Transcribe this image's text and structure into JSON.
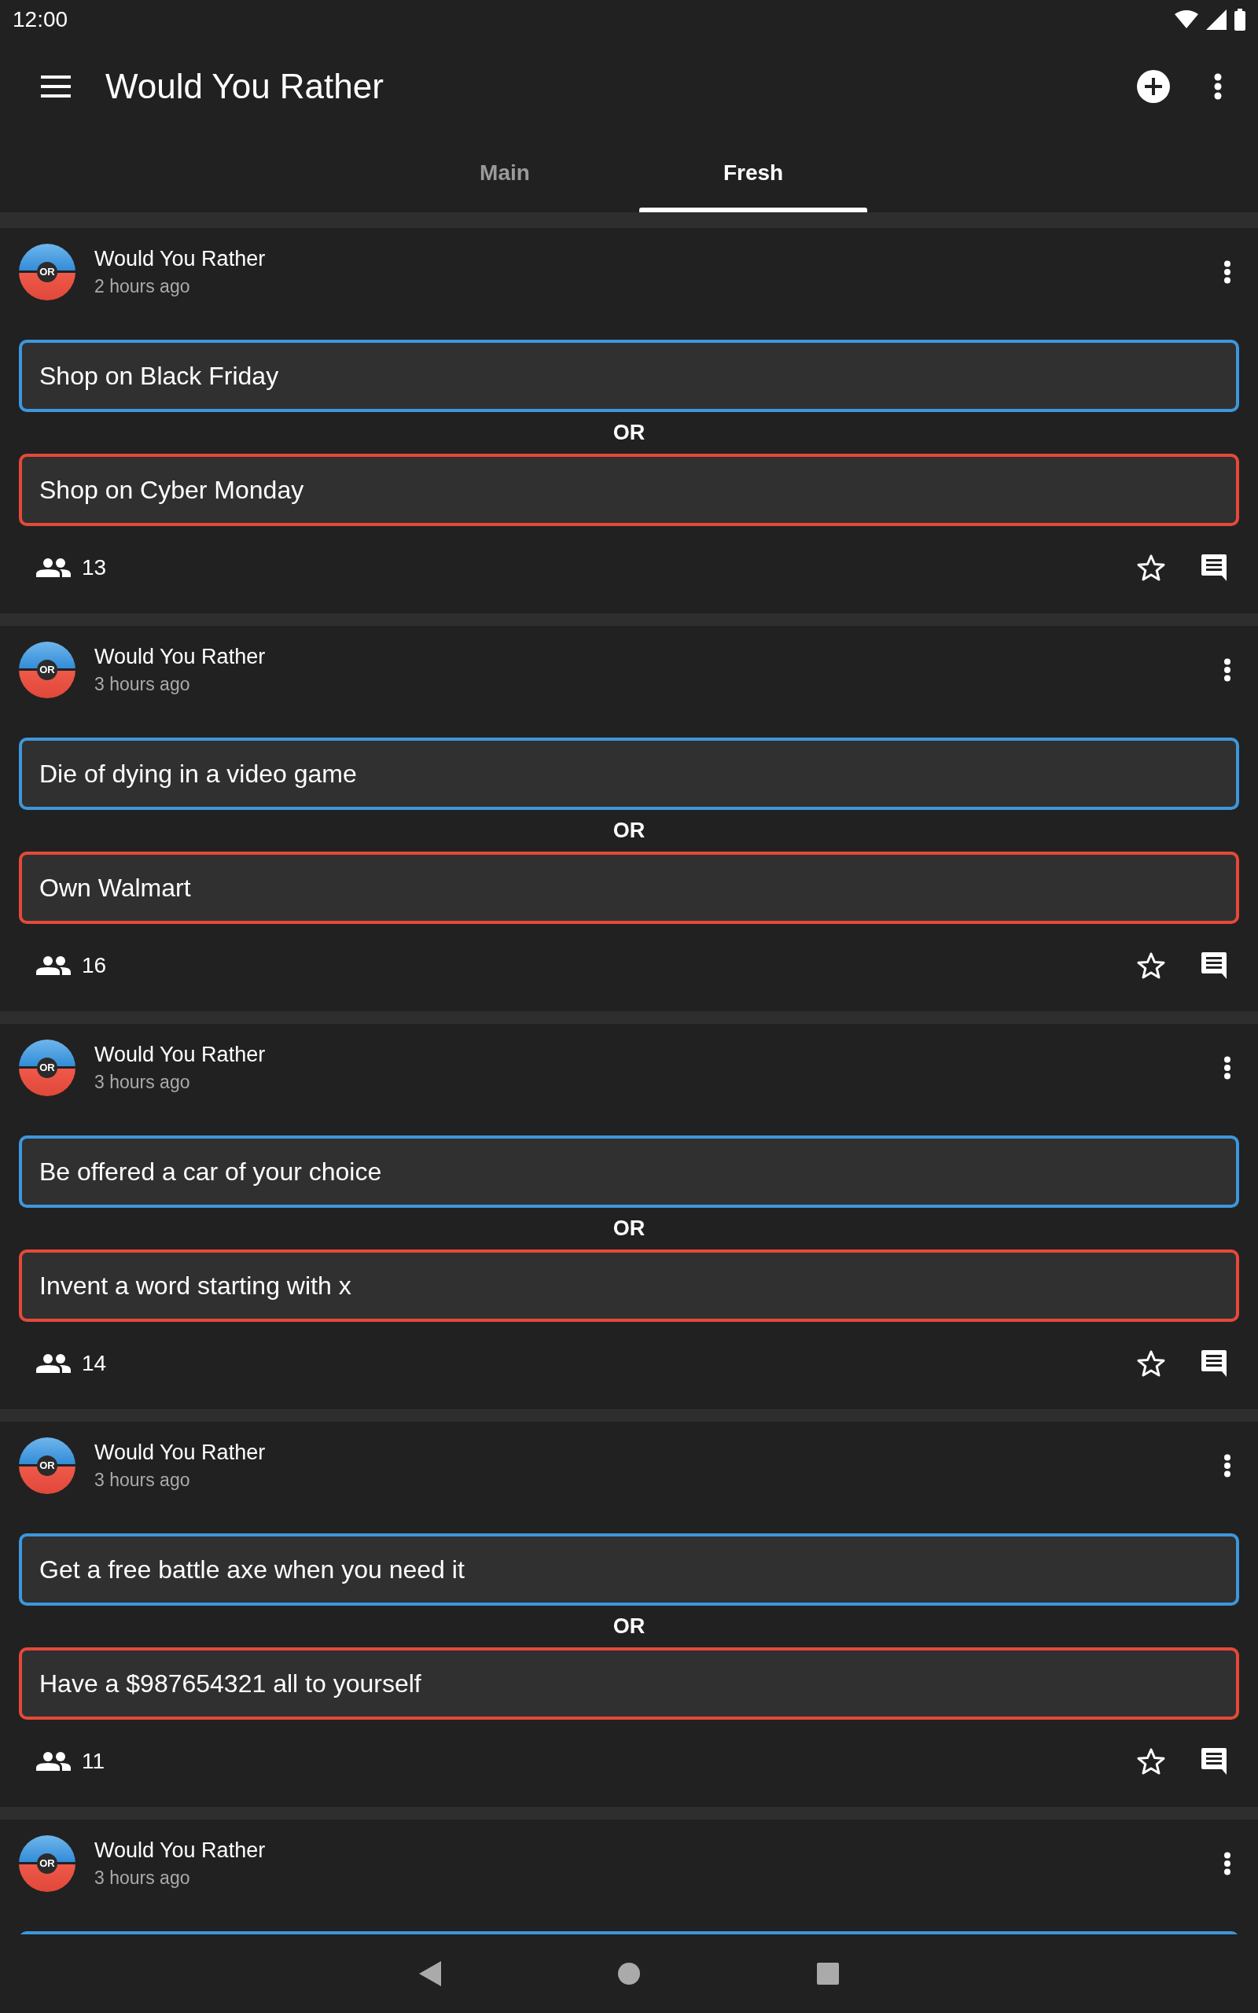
{
  "status_bar": {
    "time": "12:00"
  },
  "app_bar": {
    "title": "Would You Rather"
  },
  "tabs": [
    {
      "label": "Main",
      "selected": false
    },
    {
      "label": "Fresh",
      "selected": true
    }
  ],
  "posts": [
    {
      "author": "Would You Rather",
      "avatar_text": "OR",
      "time": "2 hours ago",
      "options": [
        {
          "text": "Shop on Black Friday",
          "color": "#3d97dc"
        },
        {
          "text": "Shop on Cyber Monday",
          "color": "#e5493a"
        }
      ],
      "separator": "OR",
      "votes": "13",
      "starred": false
    },
    {
      "author": "Would You Rather",
      "avatar_text": "OR",
      "time": "3 hours ago",
      "options": [
        {
          "text": "Die of dying in a video game",
          "color": "#3d97dc"
        },
        {
          "text": "Own Walmart",
          "color": "#e5493a"
        }
      ],
      "separator": "OR",
      "votes": "16",
      "starred": false
    },
    {
      "author": "Would You Rather",
      "avatar_text": "OR",
      "time": "3 hours ago",
      "options": [
        {
          "text": "Be offered a car of your choice",
          "color": "#3d97dc"
        },
        {
          "text": "Invent a word starting with x",
          "color": "#e5493a"
        }
      ],
      "separator": "OR",
      "votes": "14",
      "starred": false
    },
    {
      "author": "Would You Rather",
      "avatar_text": "OR",
      "time": "3 hours ago",
      "options": [
        {
          "text": "Get a free battle axe when you need it",
          "color": "#3d97dc"
        },
        {
          "text": "Have a $987654321 all to yourself",
          "color": "#e5493a"
        }
      ],
      "separator": "OR",
      "votes": "11",
      "starred": false
    },
    {
      "author": "Would You Rather",
      "avatar_text": "OR",
      "time": "3 hours ago",
      "options": [
        {
          "color": "#3d97dc"
        }
      ]
    }
  ]
}
